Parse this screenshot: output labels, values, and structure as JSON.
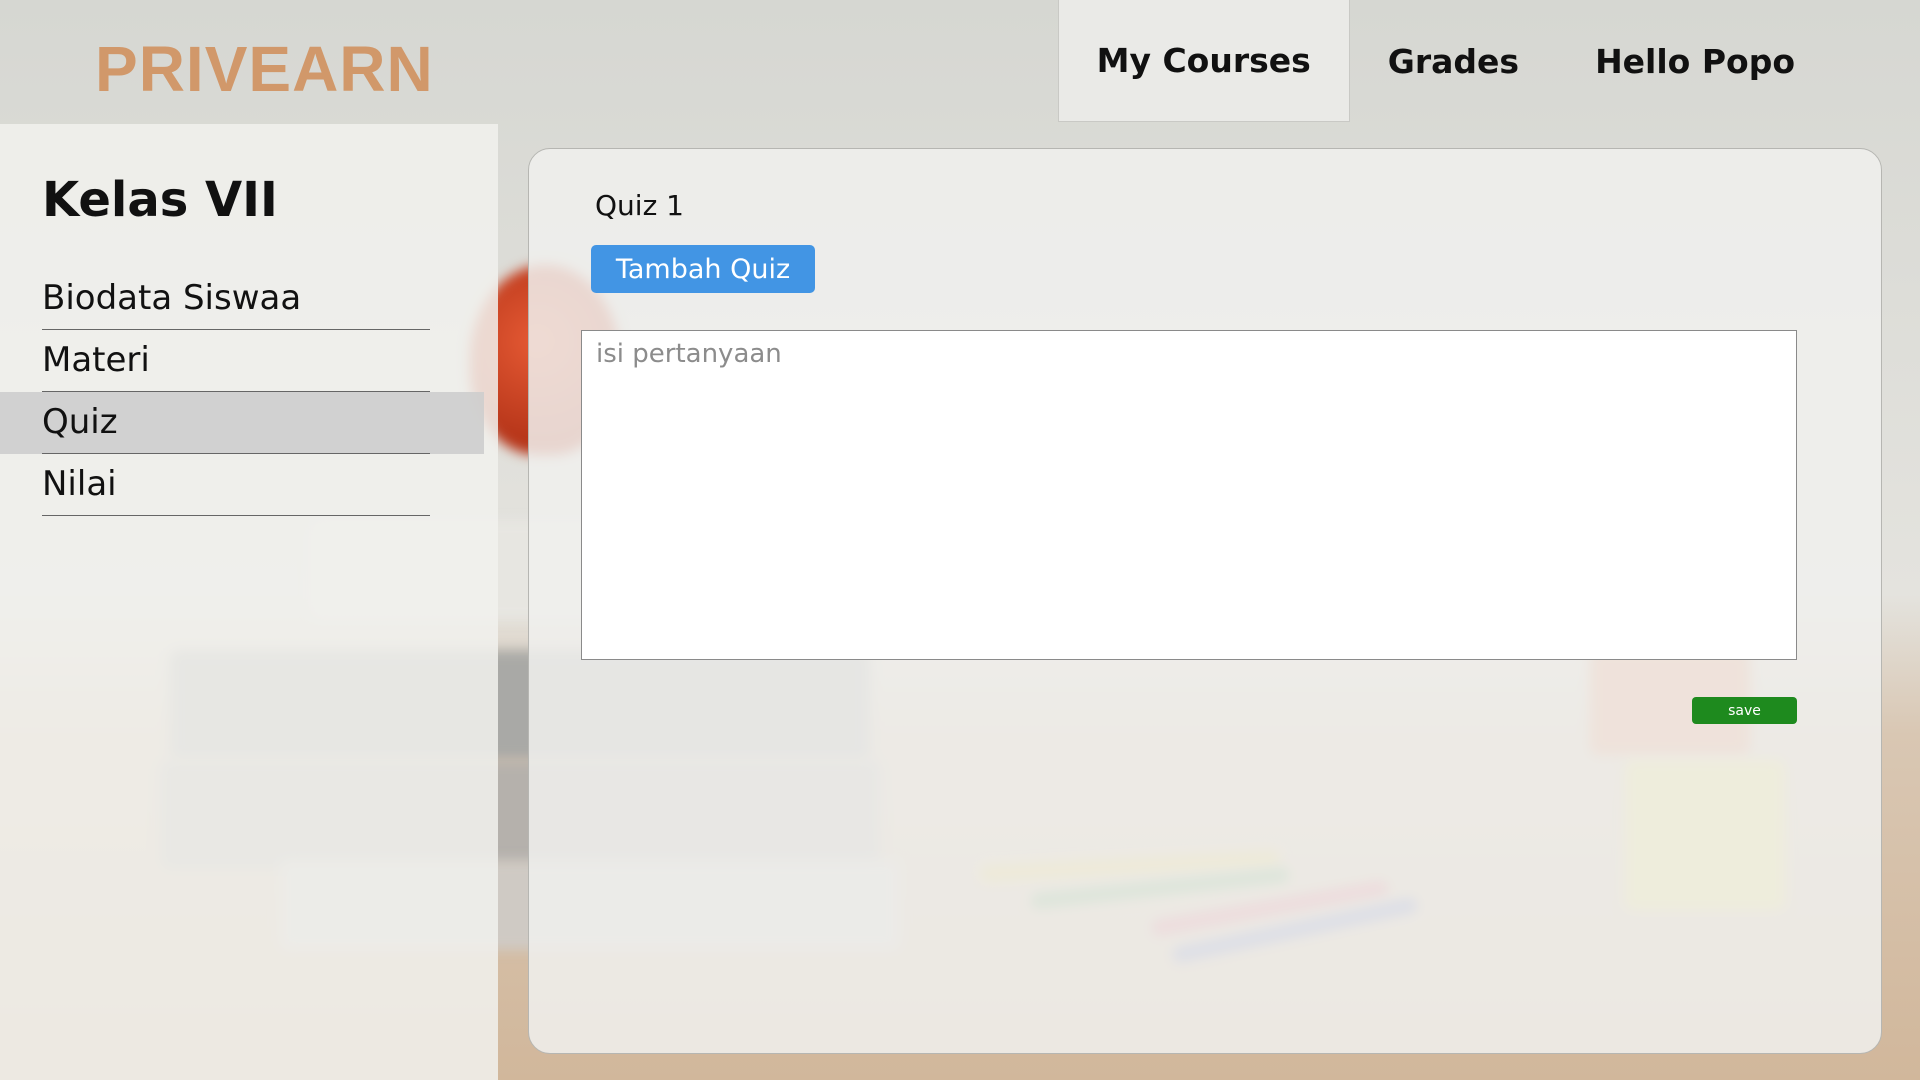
{
  "brand": {
    "logo_text": "PRIVEARN"
  },
  "nav": {
    "my_courses": "My Courses",
    "grades": "Grades",
    "user_greeting": "Hello Popo"
  },
  "sidebar": {
    "title": "Kelas VII",
    "items": [
      {
        "label": "Biodata Siswaa",
        "active": false
      },
      {
        "label": "Materi",
        "active": false
      },
      {
        "label": "Quiz",
        "active": true
      },
      {
        "label": "Nilai",
        "active": false
      }
    ]
  },
  "main": {
    "quiz_title": "Quiz 1",
    "add_quiz_label": "Tambah Quiz",
    "question_placeholder": "isi pertanyaan",
    "question_value": "",
    "save_label": "save"
  },
  "colors": {
    "brand": "#d1986a",
    "primary_button": "#4295e4",
    "save_button": "#1e8a1e"
  }
}
